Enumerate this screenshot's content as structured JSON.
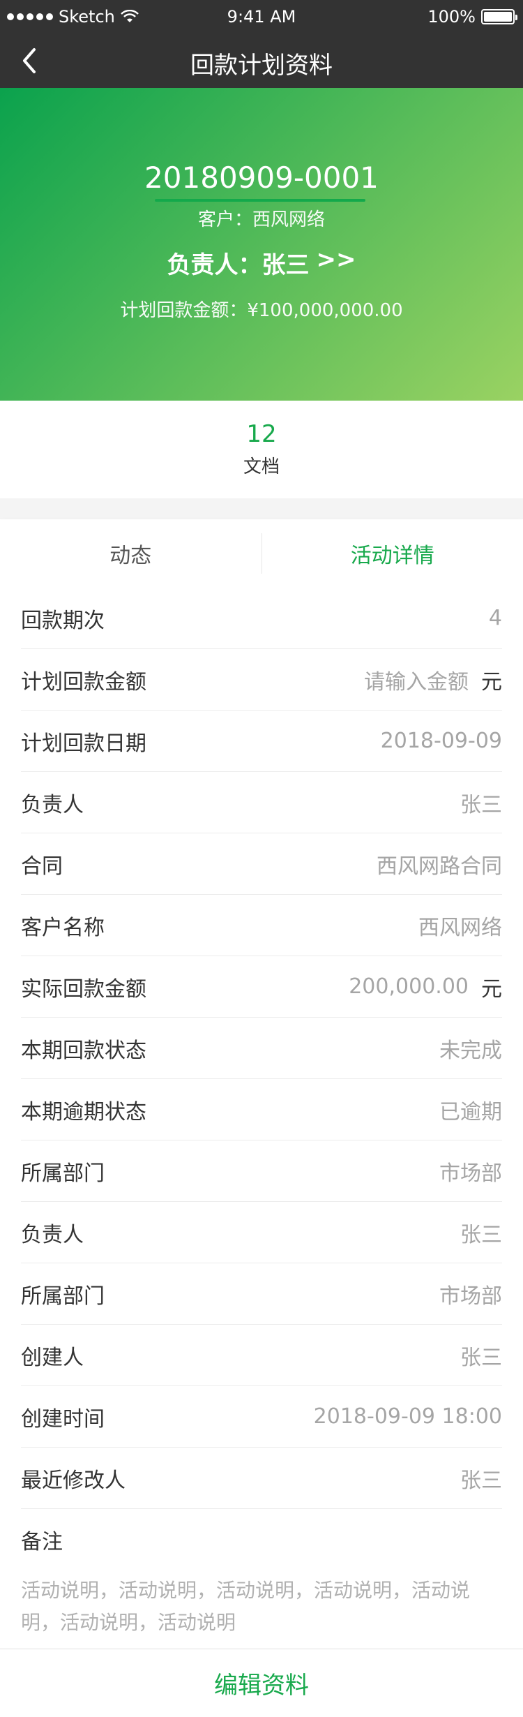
{
  "status_bar": {
    "carrier": "Sketch",
    "time": "9:41 AM",
    "battery": "100%"
  },
  "nav": {
    "title": "回款计划资料"
  },
  "header": {
    "code": "20180909-0001",
    "customer": "客户：西风网络",
    "owner_label": "负责人：张三",
    "owner_link": ">>",
    "planned_amount": "计划回款金额：¥100,000,000.00"
  },
  "docs": {
    "count": "12",
    "label": "文档"
  },
  "tabs": {
    "activity": "动态",
    "details": "活动详情"
  },
  "rows": [
    {
      "label": "回款期次",
      "value": "4"
    },
    {
      "label": "计划回款金额",
      "value": "请输入金额",
      "unit": "元"
    },
    {
      "label": "计划回款日期",
      "value": "2018-09-09"
    },
    {
      "label": "负责人",
      "value": "张三"
    },
    {
      "label": "合同",
      "value": "西风网路合同"
    },
    {
      "label": "客户名称",
      "value": "西风网络"
    },
    {
      "label": "实际回款金额",
      "value": "200,000.00",
      "unit": "元"
    },
    {
      "label": "本期回款状态",
      "value": "未完成"
    },
    {
      "label": "本期逾期状态",
      "value": "已逾期"
    },
    {
      "label": "所属部门",
      "value": "市场部"
    },
    {
      "label": "负责人",
      "value": "张三"
    },
    {
      "label": "所属部门",
      "value": "市场部"
    },
    {
      "label": "创建人",
      "value": "张三"
    },
    {
      "label": "创建时间",
      "value": "2018-09-09 18:00"
    },
    {
      "label": "最近修改人",
      "value": "张三"
    }
  ],
  "notes": {
    "label": "备注",
    "text": "活动说明，活动说明，活动说明，活动说明，活动说明，活动说明，活动说明"
  },
  "footer": {
    "edit_label": "编辑资料"
  }
}
